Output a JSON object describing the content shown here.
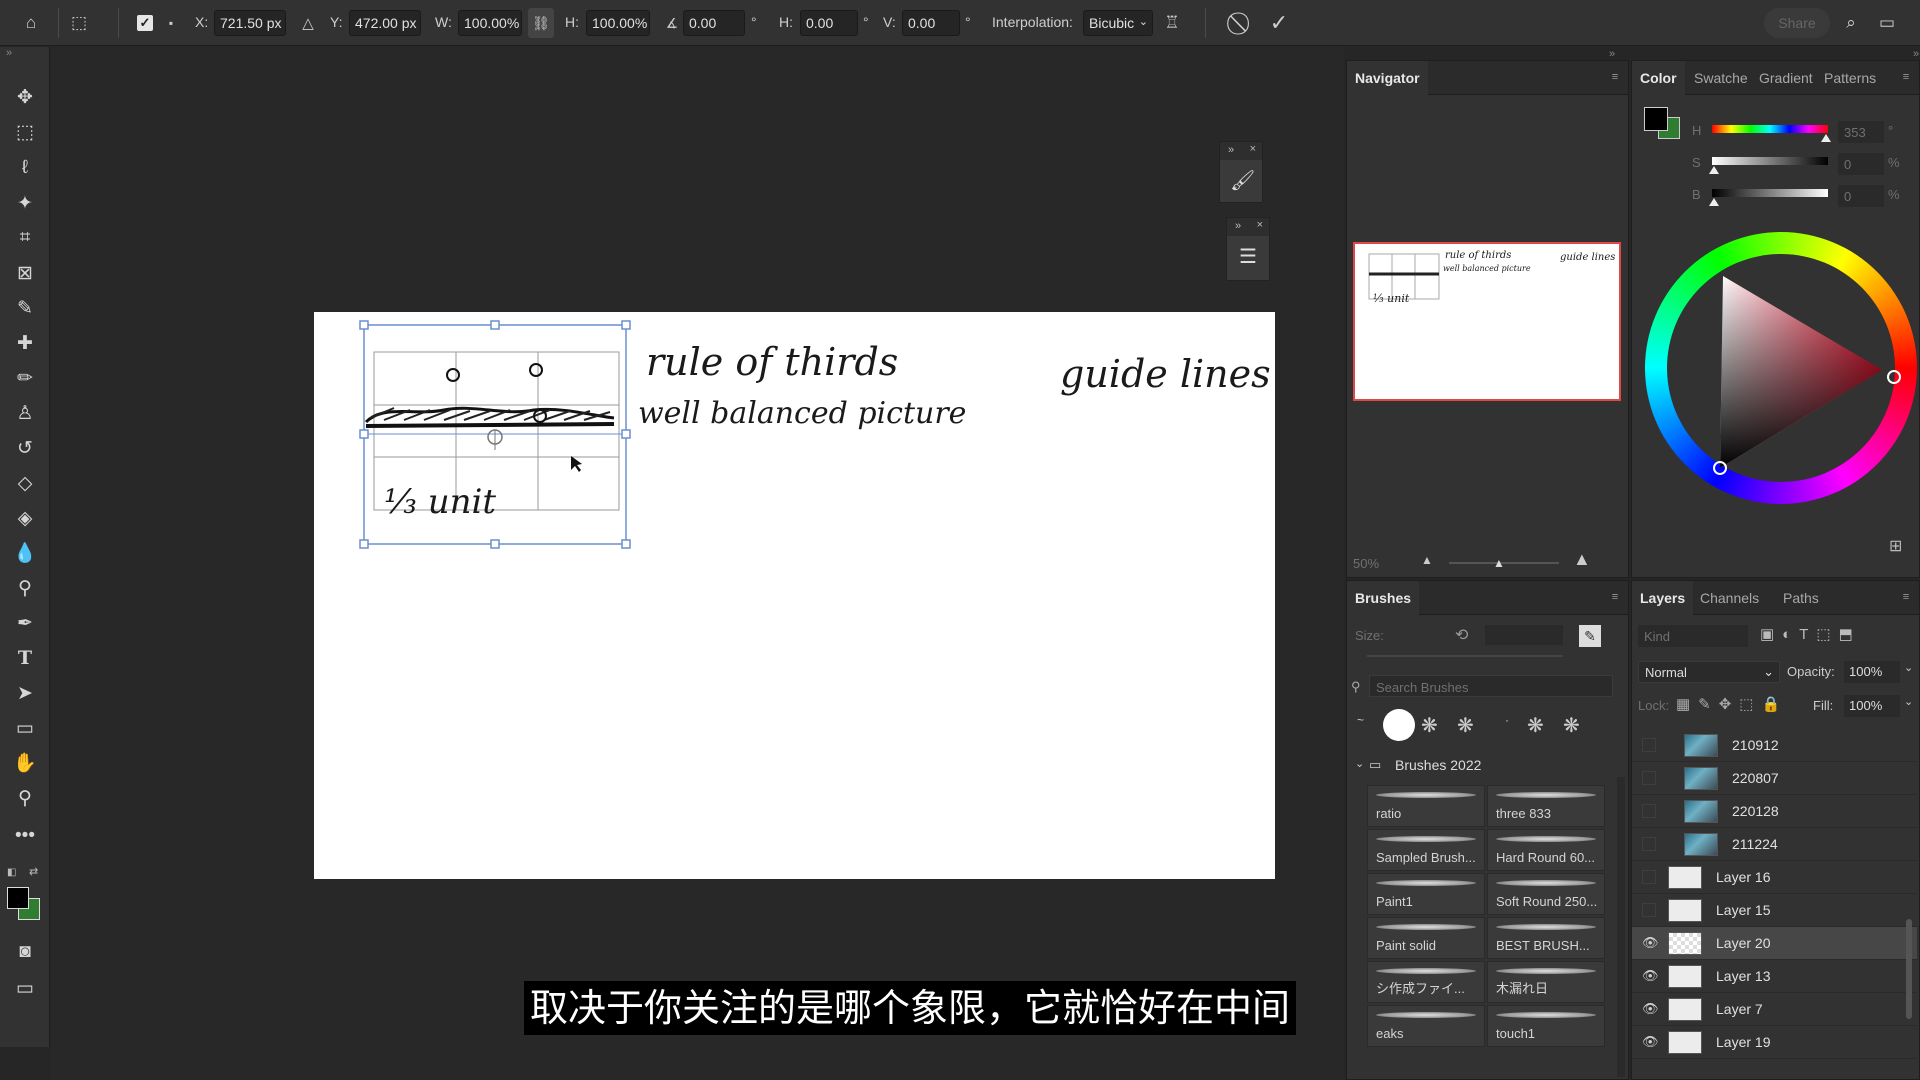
{
  "options_bar": {
    "x_label": "X:",
    "x_value": "721.50 px",
    "y_label": "Y:",
    "y_value": "472.00 px",
    "w_label": "W:",
    "w_value": "100.00%",
    "h_label": "H:",
    "h_value": "100.00%",
    "angle_value": "0.00",
    "angle_unit": "°",
    "skew_h_label": "H:",
    "skew_h_value": "0.00",
    "skew_h_unit": "°",
    "skew_v_label": "V:",
    "skew_v_value": "0.00",
    "skew_v_unit": "°",
    "interp_label": "Interpolation:",
    "interp_value": "Bicubic",
    "share_label": "Share"
  },
  "canvas": {
    "text_rule": "rule of thirds",
    "text_balanced": "well balanced picture",
    "text_guide": "guide lines",
    "text_unit": "⅓ unit"
  },
  "navigator": {
    "tab": "Navigator",
    "zoom": "50%",
    "thumb_rule": "rule of thirds",
    "thumb_balanced": "well balanced picture",
    "thumb_guide": "guide lines",
    "thumb_unit": "⅓ unit"
  },
  "color_panel": {
    "tabs": [
      "Color",
      "Swatche",
      "Gradient",
      "Patterns"
    ],
    "h_label": "H",
    "h_value": "353",
    "h_unit": "°",
    "s_label": "S",
    "s_value": "0",
    "s_unit": "%",
    "b_label": "B",
    "b_value": "0",
    "b_unit": "%",
    "foreground": "#000000",
    "background": "#2e7d32"
  },
  "brushes": {
    "tab": "Brushes",
    "size_label": "Size:",
    "search_placeholder": "Search Brushes",
    "group": "Brushes 2022",
    "items": [
      [
        "ratio",
        "three 833"
      ],
      [
        "Sampled Brush...",
        "Hard Round 60..."
      ],
      [
        "Paint1",
        "Soft Round 250..."
      ],
      [
        "Paint solid",
        "BEST BRUSH..."
      ],
      [
        "シ作成ファイ...",
        "木漏れ日"
      ],
      [
        "eaks",
        "touch1"
      ]
    ]
  },
  "layers": {
    "tabs": [
      "Layers",
      "Channels",
      "Paths"
    ],
    "kind_placeholder": "Kind",
    "blend_mode": "Normal",
    "opacity_label": "Opacity:",
    "opacity_value": "100%",
    "lock_label": "Lock:",
    "fill_label": "Fill:",
    "fill_value": "100%",
    "items": [
      {
        "name": "210912",
        "visible": false,
        "thumb": "image",
        "selected": false
      },
      {
        "name": "220807",
        "visible": false,
        "thumb": "image",
        "selected": false
      },
      {
        "name": "220128",
        "visible": false,
        "thumb": "image",
        "selected": false
      },
      {
        "name": "211224",
        "visible": false,
        "thumb": "image",
        "selected": false
      },
      {
        "name": "Layer 16",
        "visible": false,
        "thumb": "plain",
        "selected": false
      },
      {
        "name": "Layer 15",
        "visible": false,
        "thumb": "plain",
        "selected": false
      },
      {
        "name": "Layer 20",
        "visible": true,
        "thumb": "transparent",
        "selected": true
      },
      {
        "name": "Layer 13",
        "visible": true,
        "thumb": "plain",
        "selected": false
      },
      {
        "name": "Layer 7",
        "visible": true,
        "thumb": "plain",
        "selected": false
      },
      {
        "name": "Layer 19",
        "visible": true,
        "thumb": "plain",
        "selected": false
      }
    ]
  },
  "subtitle": "取决于你关注的是哪个象限，它就恰好在中间"
}
